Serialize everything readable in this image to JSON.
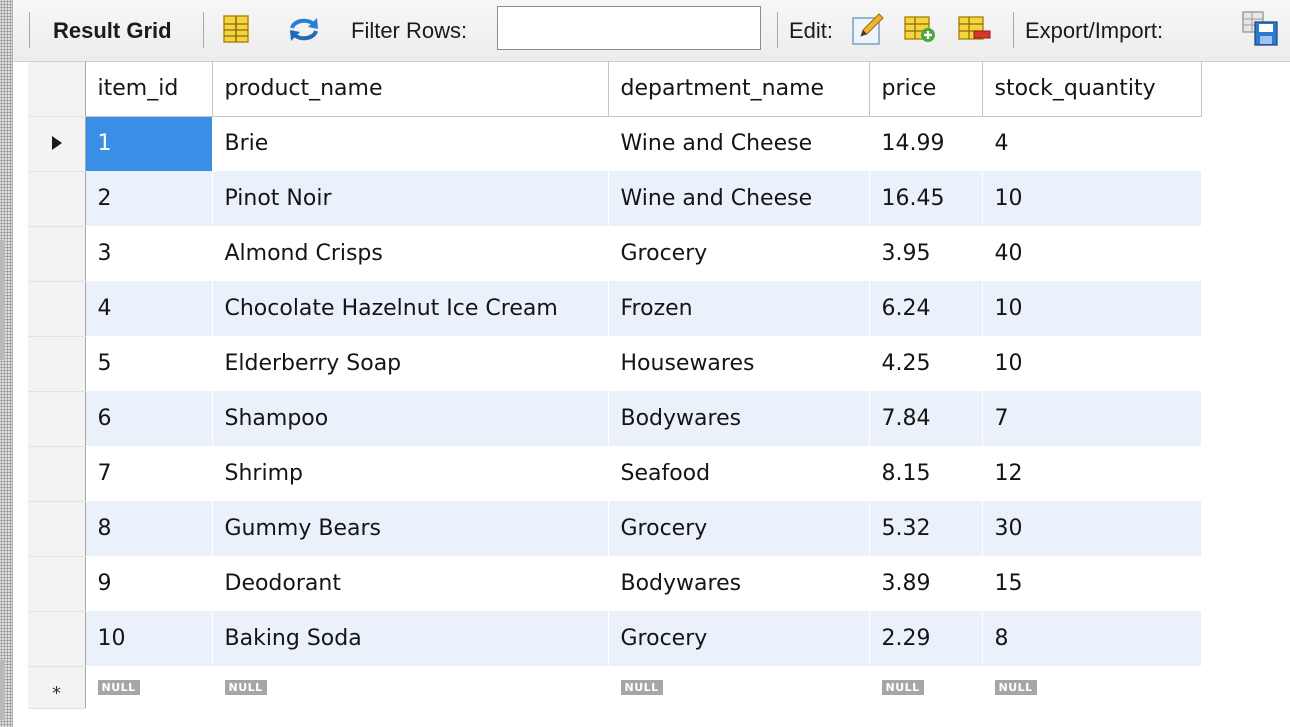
{
  "toolbar": {
    "result_grid_label": "Result Grid",
    "filter_rows_label": "Filter Rows:",
    "filter_value": "",
    "edit_label": "Edit:",
    "export_import_label": "Export/Import:"
  },
  "grid": {
    "columns": [
      "item_id",
      "product_name",
      "department_name",
      "price",
      "stock_quantity"
    ],
    "rows": [
      [
        "1",
        "Brie",
        "Wine and Cheese",
        "14.99",
        "4"
      ],
      [
        "2",
        "Pinot Noir",
        "Wine and Cheese",
        "16.45",
        "10"
      ],
      [
        "3",
        "Almond Crisps",
        "Grocery",
        "3.95",
        "40"
      ],
      [
        "4",
        "Chocolate Hazelnut Ice Cream",
        "Frozen",
        "6.24",
        "10"
      ],
      [
        "5",
        "Elderberry Soap",
        "Housewares",
        "4.25",
        "10"
      ],
      [
        "6",
        "Shampoo",
        "Bodywares",
        "7.84",
        "7"
      ],
      [
        "7",
        "Shrimp",
        "Seafood",
        "8.15",
        "12"
      ],
      [
        "8",
        "Gummy Bears",
        "Grocery",
        "5.32",
        "30"
      ],
      [
        "9",
        "Deodorant",
        "Bodywares",
        "3.89",
        "15"
      ],
      [
        "10",
        "Baking Soda",
        "Grocery",
        "2.29",
        "8"
      ]
    ],
    "null_label": "NULL",
    "new_row_marker": "*"
  },
  "colors": {
    "selection": "#3b8ee6",
    "alt_row": "#eaf1fb",
    "null_badge": "#a6a6a6"
  },
  "icons": {
    "form_editor": "form-grid-icon",
    "refresh": "refresh-arrows-icon",
    "edit_cell": "edit-pencil-icon",
    "add_row": "add-row-icon",
    "delete_row": "delete-row-icon",
    "export": "export-save-icon"
  }
}
